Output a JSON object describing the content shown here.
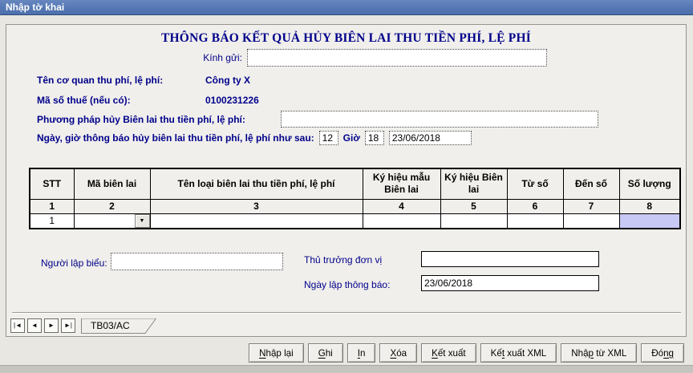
{
  "window": {
    "title": "Nhập tờ khai"
  },
  "form": {
    "title": "THÔNG BÁO KẾT QUẢ HỦY BIÊN LAI THU TIỀN PHÍ, LỆ PHÍ",
    "fields": {
      "kinh_gui": {
        "label": "Kính gửi:",
        "value": ""
      },
      "ten_co_quan": {
        "label": "Tên cơ quan thu phí, lệ phí:",
        "value": "Công ty X"
      },
      "ma_so_thue": {
        "label": "Mã số thuế (nếu có):",
        "value": "0100231226"
      },
      "phuong_phap": {
        "label": "Phương pháp hủy Biên lai thu tiền phí, lệ phí:",
        "value": ""
      },
      "ngay_gio": {
        "label": "Ngày, giờ thông báo hủy biên lai thu tiền phí, lệ phí như sau:",
        "hour": "12",
        "gio_label": "Giờ",
        "minute": "18",
        "date": "23/06/2018"
      },
      "nguoi_lap_bieu": {
        "label": "Người lập biểu:",
        "value": ""
      },
      "thu_truong": {
        "label": "Thủ trưởng đơn vị",
        "value": ""
      },
      "ngay_lap": {
        "label": "Ngày lập thông báo:",
        "value": "23/06/2018"
      }
    },
    "table": {
      "headers": [
        "STT",
        "Mã biên lai",
        "Tên loại biên lai thu tiền phí, lệ phí",
        "Ký hiệu mẫu Biên lai",
        "Ký hiệu Biên lai",
        "Từ số",
        "Đến số",
        "Số lượng"
      ],
      "column_numbers": [
        "1",
        "2",
        "3",
        "4",
        "5",
        "6",
        "7",
        "8"
      ],
      "rows": [
        {
          "stt": "1",
          "ma_bien_lai": "",
          "ten_loai": "",
          "ky_hieu_mau": "",
          "ky_hieu": "",
          "tu_so": "",
          "den_so": "",
          "so_luong": ""
        }
      ]
    },
    "tab": {
      "label": "TB03/AC"
    },
    "nav": [
      {
        "name": "first",
        "glyph": "|◄"
      },
      {
        "name": "prev",
        "glyph": "◄"
      },
      {
        "name": "next",
        "glyph": "►"
      },
      {
        "name": "last",
        "glyph": "►|"
      }
    ],
    "combo_arrow": "▼"
  },
  "actions": [
    {
      "pre": "",
      "key": "N",
      "post": "hập lại"
    },
    {
      "pre": "",
      "key": "G",
      "post": "hi"
    },
    {
      "pre": "",
      "key": "I",
      "post": "n"
    },
    {
      "pre": "",
      "key": "X",
      "post": "óa"
    },
    {
      "pre": "",
      "key": "K",
      "post": "ết xuất"
    },
    {
      "pre": "Kế",
      "key": "t",
      "post": " xuất XML"
    },
    {
      "pre": "Nhậ",
      "key": "p",
      "post": " từ XML"
    },
    {
      "pre": "Đó",
      "key": "ng",
      "post": ""
    }
  ],
  "colors": {
    "titlebar_blue": "#5578b4",
    "label_navy": "#00008B",
    "panel_grey": "#f0efeb",
    "highlight_cell": "#c9c9f5"
  }
}
